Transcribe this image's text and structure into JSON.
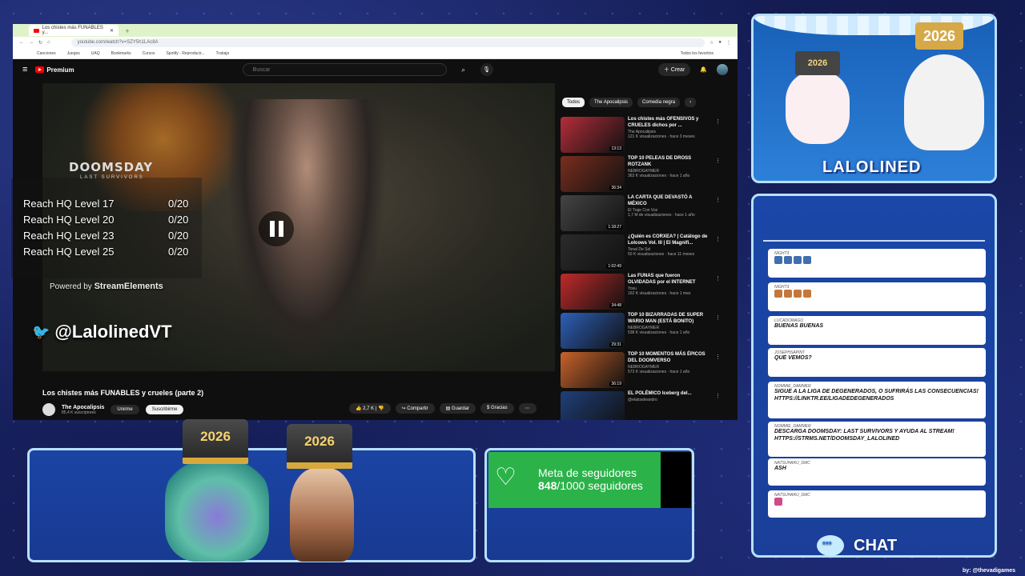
{
  "browser": {
    "tab_title": "Los chistes más FUNABLES y...",
    "url": "youtube.com/watch?v=SZY5h1LAc8A",
    "bookmarks": [
      "Canciones",
      "Juegos",
      "UAQ",
      "Bookmarks",
      "Cursos",
      "Spotify - Reproducir...",
      "Trabajo",
      "Todos los favoritos"
    ]
  },
  "youtube": {
    "brand": "Premium",
    "search_placeholder": "Buscar",
    "create_label": "Crear",
    "video_title": "Los chistes más FUNABLES y crueles (parte 2)",
    "channel_name": "The Apocalipsis",
    "channel_subs": "85,4 K suscriptores",
    "join_label": "Unirme",
    "subscribe_label": "Suscribirme",
    "likes": "2,7 K",
    "share_label": "Compartir",
    "save_label": "Guardar",
    "thanks_label": "Gracias",
    "chips": [
      "Todos",
      "The Apocalipsis",
      "Comedia negra"
    ],
    "recs": [
      {
        "title": "Los chistes más OFENSIVOS y CRUELES dichos por ...",
        "channel": "The Apocalipsis",
        "meta": "121 K visualizaciones · hace 3 meses",
        "duration": "13:13",
        "color": "#b42d3a"
      },
      {
        "title": "TOP 10 PELEAS DE DROSS ROTZANK",
        "channel": "NEBROGAYMER",
        "meta": "363 K visualizaciones · hace 1 año",
        "duration": "36:34",
        "color": "#7a2d1e"
      },
      {
        "title": "LA CARTA QUE DEVASTÓ A MÉXICO",
        "channel": "El Traje Con Voz",
        "meta": "1,7 M de visualizaciones · hace 1 año",
        "duration": "1:18:27",
        "color": "#444"
      },
      {
        "title": "¿Quién es CORXEA? | Catálogo de Lolcows Vol. III | El Magnifi...",
        "channel": "Tonal De Sol",
        "meta": "50 K visualizaciones · hace 11 meses",
        "duration": "1:02:49",
        "color": "#2b2b2b"
      },
      {
        "title": "Las FUNAS que fueron OLVIDADAS por el INTERNET",
        "channel": "Yosu",
        "meta": "162 K visualizaciones · hace 1 mes",
        "duration": "34:48",
        "color": "#c02a2a"
      },
      {
        "title": "TOP 10 BIZARRADAS DE SUPER WARIO MAN (ESTÁ BONITO)",
        "channel": "NEBROGAYMER",
        "meta": "538 K visualizaciones · hace 1 año",
        "duration": "29:31",
        "color": "#2d5fb8"
      },
      {
        "title": "TOP 10 MOMENTOS MÁS ÉPICOS DEL DOOMVERSO",
        "channel": "NEBROGAYMER",
        "meta": "573 K visualizaciones · hace 1 año",
        "duration": "36:19",
        "color": "#c8622a"
      },
      {
        "title": "EL POLÉMICO Iceberg del...",
        "channel": "@elatosdeandro",
        "meta": "",
        "duration": "",
        "color": "#1f3f7a"
      }
    ]
  },
  "overlay": {
    "game_logo": "DOOMSDAY",
    "game_sub": "LAST SURVIVORS",
    "objectives": [
      {
        "label": "Reach HQ Level 17",
        "value": "0/20"
      },
      {
        "label": "Reach HQ Level 20",
        "value": "0/20"
      },
      {
        "label": "Reach HQ Level 23",
        "value": "0/20"
      },
      {
        "label": "Reach HQ Level 25",
        "value": "0/20"
      }
    ],
    "powered_prefix": "Powered by",
    "powered_brand": "StreamElements",
    "twitter_handle": "@LalolinedVT"
  },
  "stream": {
    "name_plate": "LALOLINED",
    "hat_year": "2026",
    "chat_label": "CHAT",
    "credit": "by: @thevadigames"
  },
  "chat": [
    {
      "user": "NIGHT3",
      "text": "",
      "emotes": [
        "#3f6fb0",
        "#3f6fb0",
        "#3f6fb0",
        "#3f6fb0"
      ]
    },
    {
      "user": "NIGHT3",
      "text": "",
      "emotes": [
        "#c5773a",
        "#c5773a",
        "#c5773a",
        "#c5773a"
      ]
    },
    {
      "user": "LUCADOMAGO",
      "text": "BUENAS BUENAS",
      "emotes": []
    },
    {
      "user": "JOSEPHSAPINT",
      "text": "QUE VEMOS?",
      "emotes": []
    },
    {
      "user": "NOMMIE_DAMMER",
      "text": "SIGUE A LA LIGA DE DEGENERADOS, O SUFRIRÁS LAS CONSECUENCIAS! HTTPS://LINKTR.EE/LIGADEDEGENERADOS",
      "emotes": []
    },
    {
      "user": "NOMMIE_DAMMER",
      "text": "DESCARGA DOOMSDAY: LAST SURVIVORS Y AYUDA AL STREAM! HTTPS://STRMS.NET/DOOMSDAY_LALOLINED",
      "emotes": []
    },
    {
      "user": "NATSUHARU_DMC",
      "text": "ASH",
      "emotes": []
    },
    {
      "user": "NATSUHARU_DMC",
      "text": "",
      "emotes": [
        "#d04a8a"
      ]
    }
  ],
  "goal": {
    "title": "Meta de seguidores",
    "current": "848",
    "total": "/1000 seguidores",
    "progress": 0.848
  }
}
